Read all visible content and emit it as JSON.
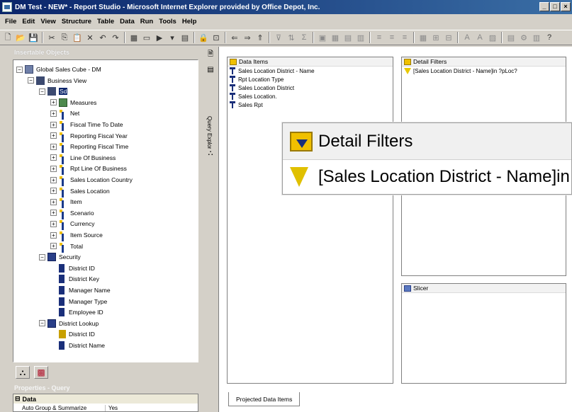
{
  "window": {
    "title": "DM Test - NEW* - Report Studio - Microsoft Internet Explorer provided by Office Depot, Inc.",
    "controls": [
      "_",
      "□",
      "×"
    ]
  },
  "menu": [
    "File",
    "Edit",
    "View",
    "Structure",
    "Table",
    "Data",
    "Run",
    "Tools",
    "Help"
  ],
  "insertable": {
    "header": "Insertable Objects",
    "tree": [
      {
        "label": "Global Sales Cube - DM",
        "icon": "cube-icon",
        "level": 0,
        "exp": "−"
      },
      {
        "label": "Business View",
        "icon": "folder-icon",
        "level": 1,
        "exp": "−"
      },
      {
        "label": "Sd",
        "icon": "folder-icon",
        "level": 2,
        "exp": "−",
        "selected": true
      },
      {
        "label": "Measures",
        "icon": "measures-icon",
        "level": 3,
        "exp": "+"
      },
      {
        "label": "Net",
        "icon": "dimension-icon",
        "level": 3,
        "exp": "+"
      },
      {
        "label": "Fiscal Time To Date",
        "icon": "dimension-icon",
        "level": 3,
        "exp": "+"
      },
      {
        "label": "Reporting Fiscal Year",
        "icon": "dimension-icon",
        "level": 3,
        "exp": "+"
      },
      {
        "label": "Reporting Fiscal Time",
        "icon": "dimension-icon",
        "level": 3,
        "exp": "+"
      },
      {
        "label": "Line Of Business",
        "icon": "dimension-icon",
        "level": 3,
        "exp": "+"
      },
      {
        "label": "Rpt Line Of Business",
        "icon": "dimension-icon",
        "level": 3,
        "exp": "+"
      },
      {
        "label": "Sales Location Country",
        "icon": "dimension-icon",
        "level": 3,
        "exp": "+"
      },
      {
        "label": "Sales Location",
        "icon": "dimension-icon",
        "level": 3,
        "exp": "+"
      },
      {
        "label": "Item",
        "icon": "dimension-icon",
        "level": 3,
        "exp": "+"
      },
      {
        "label": "Scenario",
        "icon": "dimension-icon",
        "level": 3,
        "exp": "+"
      },
      {
        "label": "Currency",
        "icon": "dimension-icon",
        "level": 3,
        "exp": "+"
      },
      {
        "label": "Item Source",
        "icon": "dimension-icon",
        "level": 3,
        "exp": "+"
      },
      {
        "label": "Total",
        "icon": "dimension-icon",
        "level": 3,
        "exp": "+"
      },
      {
        "label": "Security",
        "icon": "security-icon",
        "level": 2,
        "exp": "−"
      },
      {
        "label": "District ID",
        "icon": "level-icon",
        "level": 3,
        "exp": ""
      },
      {
        "label": "District Key",
        "icon": "level-icon",
        "level": 3,
        "exp": ""
      },
      {
        "label": "Manager Name",
        "icon": "level-icon",
        "level": 3,
        "exp": ""
      },
      {
        "label": "Manager Type",
        "icon": "level-icon",
        "level": 3,
        "exp": ""
      },
      {
        "label": "Employee ID",
        "icon": "level-icon",
        "level": 3,
        "exp": ""
      },
      {
        "label": "District Lookup",
        "icon": "security-icon",
        "level": 2,
        "exp": "−"
      },
      {
        "label": "District ID",
        "icon": "level-gold-icon",
        "level": 3,
        "exp": ""
      },
      {
        "label": "District Name",
        "icon": "level-icon",
        "level": 3,
        "exp": ""
      }
    ]
  },
  "side_strip": {
    "label": "Query Explorer"
  },
  "properties": {
    "header": "Properties - Query",
    "section": "Data",
    "rows": [
      {
        "key": "Auto Group & Summarize",
        "value": "Yes"
      }
    ]
  },
  "data_items": {
    "title": "Data Items",
    "items": [
      "Sales Location District - Name",
      "Rpt Location Type",
      "Sales Location District",
      "Sales Location.",
      "Sales Rpt"
    ]
  },
  "detail_filters": {
    "title": "Detail Filters",
    "items": [
      "[Sales Location District - Name]in ?pLoc?"
    ]
  },
  "slicer": {
    "title": "Slicer"
  },
  "bottom_tab": "Projected Data Items",
  "zoom": {
    "title": "Detail Filters",
    "text": "[Sales Location District - Name]in ?pLoc?"
  }
}
